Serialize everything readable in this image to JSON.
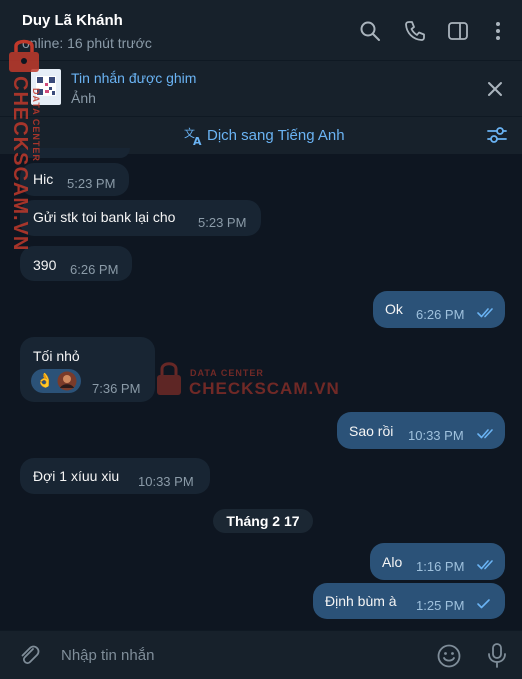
{
  "header": {
    "title": "Duy Lã Khánh",
    "status": "online: 16 phút trước"
  },
  "pinned": {
    "title": "Tin nhắn được ghim",
    "subtitle": "Ảnh"
  },
  "translate": {
    "label": "Dịch sang Tiếng Anh"
  },
  "messages": [
    {
      "dir": "in",
      "text": "Hic",
      "time": "5:23 PM"
    },
    {
      "dir": "in",
      "text": "Gửi stk toi bank lại cho",
      "time": "5:23 PM"
    },
    {
      "dir": "in",
      "text": "390",
      "time": "6:26 PM"
    },
    {
      "dir": "out",
      "text": "Ok",
      "time": "6:26 PM",
      "read": true
    },
    {
      "dir": "in",
      "text": "Tối nhỏ",
      "time": "7:36 PM",
      "reaction": "👌"
    },
    {
      "dir": "out",
      "text": "Sao rồi",
      "time": "10:33 PM",
      "read": true
    },
    {
      "dir": "in",
      "text": "Đợi 1 xíuu xiu",
      "time": "10:33 PM"
    },
    {
      "dir": "out",
      "text": "Alo",
      "time": "1:16 PM",
      "read": true
    },
    {
      "dir": "out",
      "text": "Định bùm à",
      "time": "1:25 PM",
      "read": false
    }
  ],
  "date_separator": "Tháng 2 17",
  "composer": {
    "placeholder": "Nhập tin nhắn"
  },
  "watermark": {
    "brand": "CHECKSCAM.VN",
    "tag": "DATA CENTER"
  },
  "colors": {
    "background": "#0e1621",
    "panel": "#17212b",
    "incoming_bubble": "#182533",
    "outgoing_bubble": "#2b5278",
    "accent": "#6ab3f3",
    "watermark": "#c0392b"
  }
}
